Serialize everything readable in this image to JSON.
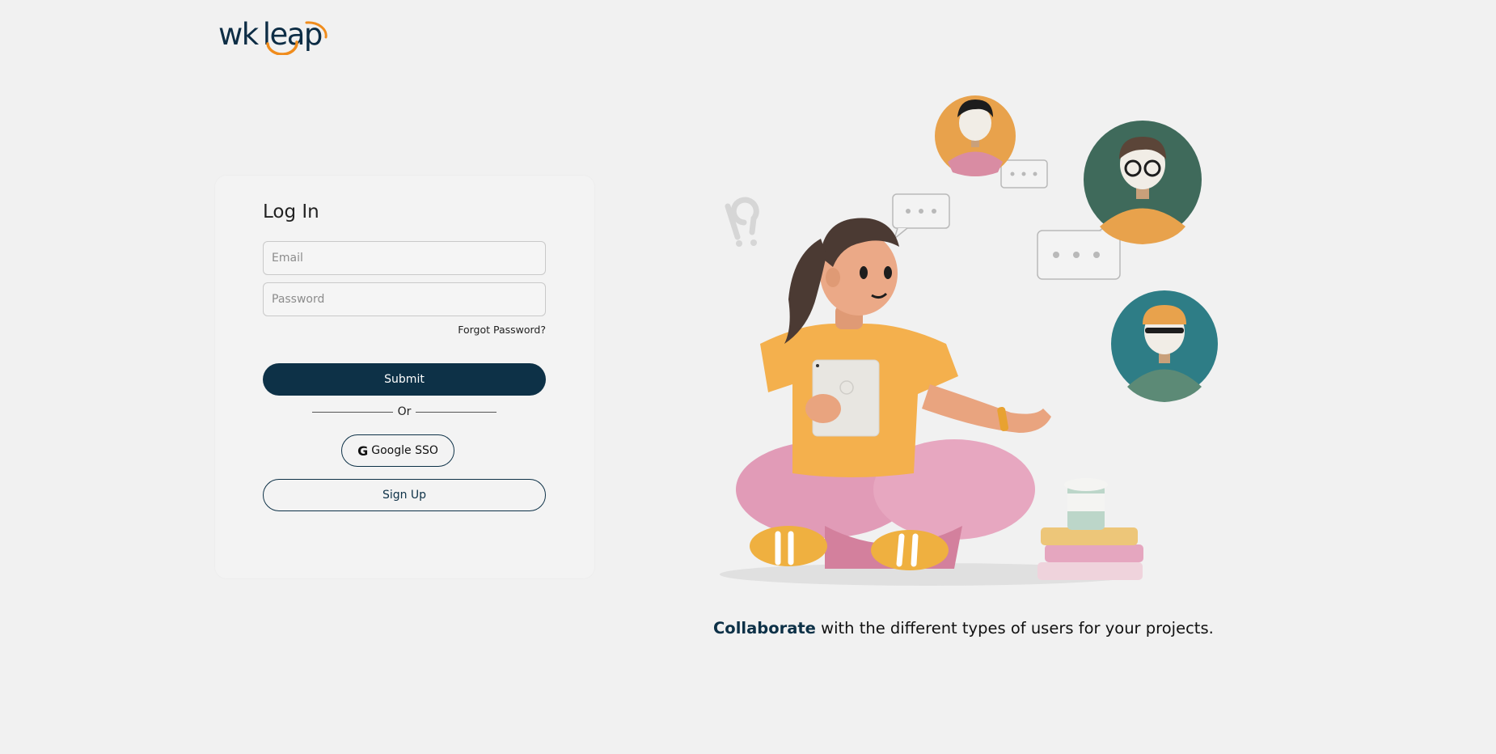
{
  "brand": {
    "logo_text": "wk leap",
    "logo_prefix": "wk",
    "logo_suffix": "leap",
    "accent_color": "#f08c1c",
    "primary_color": "#0d3147"
  },
  "login": {
    "title": "Log In",
    "email_placeholder": "Email",
    "password_placeholder": "Password",
    "forgot_label": "Forgot Password?",
    "submit_label": "Submit",
    "divider_label": "Or",
    "google_icon": "G",
    "google_label": "Google SSO",
    "signup_label": "Sign Up"
  },
  "illustration": {
    "icon": "collaboration-illustration"
  },
  "tagline": {
    "highlight": "Collaborate",
    "rest": " with the different types of users for your projects."
  }
}
